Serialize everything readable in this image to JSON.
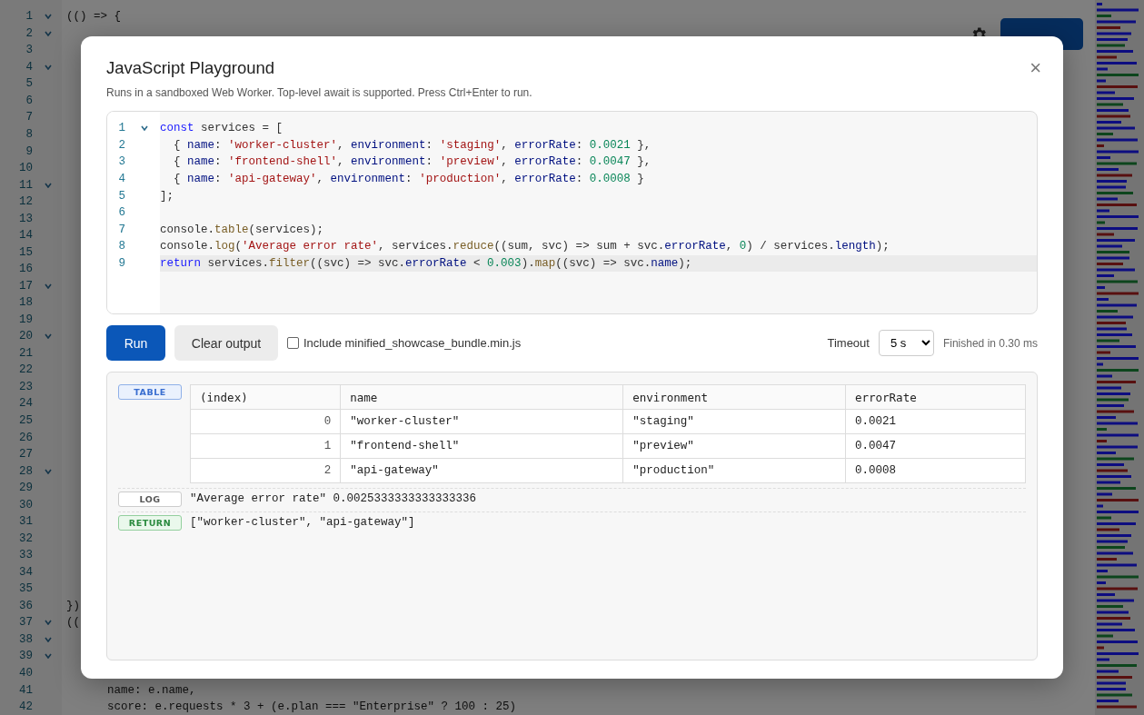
{
  "background_editor": {
    "lines": [
      {
        "number": "1",
        "fold": true,
        "code": "(() => {"
      },
      {
        "number": "2",
        "fold": true
      },
      {
        "number": "3",
        "fold": false
      },
      {
        "number": "4",
        "fold": true
      },
      {
        "number": "5",
        "fold": false
      },
      {
        "number": "6",
        "fold": false
      },
      {
        "number": "7",
        "fold": false
      },
      {
        "number": "8",
        "fold": false
      },
      {
        "number": "9",
        "fold": false
      },
      {
        "number": "10",
        "fold": false
      },
      {
        "number": "11",
        "fold": true
      },
      {
        "number": "12",
        "fold": false
      },
      {
        "number": "13",
        "fold": false
      },
      {
        "number": "14",
        "fold": false
      },
      {
        "number": "15",
        "fold": false
      },
      {
        "number": "16",
        "fold": false
      },
      {
        "number": "17",
        "fold": true
      },
      {
        "number": "18",
        "fold": false
      },
      {
        "number": "19",
        "fold": false
      },
      {
        "number": "20",
        "fold": true
      },
      {
        "number": "21",
        "fold": false
      },
      {
        "number": "22",
        "fold": false
      },
      {
        "number": "23",
        "fold": false
      },
      {
        "number": "24",
        "fold": false
      },
      {
        "number": "25",
        "fold": false
      },
      {
        "number": "26",
        "fold": false
      },
      {
        "number": "27",
        "fold": false
      },
      {
        "number": "28",
        "fold": true
      },
      {
        "number": "29",
        "fold": false
      },
      {
        "number": "30",
        "fold": false
      },
      {
        "number": "31",
        "fold": false
      },
      {
        "number": "32",
        "fold": false
      },
      {
        "number": "33",
        "fold": false
      },
      {
        "number": "34",
        "fold": false
      },
      {
        "number": "35",
        "fold": false
      },
      {
        "number": "36",
        "fold": false,
        "code": "})"
      },
      {
        "number": "37",
        "fold": true,
        "code": "(("
      },
      {
        "number": "38",
        "fold": true
      },
      {
        "number": "39",
        "fold": true
      },
      {
        "number": "40",
        "fold": false
      },
      {
        "number": "41",
        "fold": false,
        "code": "      name: e.name,"
      },
      {
        "number": "42",
        "fold": false,
        "code": "      score: e.requests * 3 + (e.plan === \"Enterprise\" ? 100 : 25)"
      }
    ]
  },
  "dialog": {
    "title": "JavaScript Playground",
    "subtitle": "Runs in a sandboxed Web Worker. Top-level await is supported. Press Ctrl+Enter to run.",
    "close": "×",
    "editor": {
      "lines": [
        {
          "number": "1",
          "fold": true,
          "current": false,
          "tokens": [
            {
              "kind": "kw",
              "text": "const"
            },
            {
              "kind": "plain",
              "text": " services = ["
            }
          ]
        },
        {
          "number": "2",
          "fold": false,
          "current": false,
          "tokens": [
            {
              "kind": "plain",
              "text": "  { "
            },
            {
              "kind": "prop",
              "text": "name"
            },
            {
              "kind": "plain",
              "text": ": "
            },
            {
              "kind": "str",
              "text": "'worker-cluster'"
            },
            {
              "kind": "plain",
              "text": ", "
            },
            {
              "kind": "prop",
              "text": "environment"
            },
            {
              "kind": "plain",
              "text": ": "
            },
            {
              "kind": "str",
              "text": "'staging'"
            },
            {
              "kind": "plain",
              "text": ", "
            },
            {
              "kind": "prop",
              "text": "errorRate"
            },
            {
              "kind": "plain",
              "text": ": "
            },
            {
              "kind": "num",
              "text": "0.0021"
            },
            {
              "kind": "plain",
              "text": " },"
            }
          ]
        },
        {
          "number": "3",
          "fold": false,
          "current": false,
          "tokens": [
            {
              "kind": "plain",
              "text": "  { "
            },
            {
              "kind": "prop",
              "text": "name"
            },
            {
              "kind": "plain",
              "text": ": "
            },
            {
              "kind": "str",
              "text": "'frontend-shell'"
            },
            {
              "kind": "plain",
              "text": ", "
            },
            {
              "kind": "prop",
              "text": "environment"
            },
            {
              "kind": "plain",
              "text": ": "
            },
            {
              "kind": "str",
              "text": "'preview'"
            },
            {
              "kind": "plain",
              "text": ", "
            },
            {
              "kind": "prop",
              "text": "errorRate"
            },
            {
              "kind": "plain",
              "text": ": "
            },
            {
              "kind": "num",
              "text": "0.0047"
            },
            {
              "kind": "plain",
              "text": " },"
            }
          ]
        },
        {
          "number": "4",
          "fold": false,
          "current": false,
          "tokens": [
            {
              "kind": "plain",
              "text": "  { "
            },
            {
              "kind": "prop",
              "text": "name"
            },
            {
              "kind": "plain",
              "text": ": "
            },
            {
              "kind": "str",
              "text": "'api-gateway'"
            },
            {
              "kind": "plain",
              "text": ", "
            },
            {
              "kind": "prop",
              "text": "environment"
            },
            {
              "kind": "plain",
              "text": ": "
            },
            {
              "kind": "str",
              "text": "'production'"
            },
            {
              "kind": "plain",
              "text": ", "
            },
            {
              "kind": "prop",
              "text": "errorRate"
            },
            {
              "kind": "plain",
              "text": ": "
            },
            {
              "kind": "num",
              "text": "0.0008"
            },
            {
              "kind": "plain",
              "text": " }"
            }
          ]
        },
        {
          "number": "5",
          "fold": false,
          "current": false,
          "tokens": [
            {
              "kind": "plain",
              "text": "];"
            }
          ]
        },
        {
          "number": "6",
          "fold": false,
          "current": false
        },
        {
          "number": "7",
          "fold": false,
          "current": false,
          "tokens": [
            {
              "kind": "plain",
              "text": "console."
            },
            {
              "kind": "fn",
              "text": "table"
            },
            {
              "kind": "plain",
              "text": "(services);"
            }
          ]
        },
        {
          "number": "8",
          "fold": false,
          "current": false,
          "tokens": [
            {
              "kind": "plain",
              "text": "console."
            },
            {
              "kind": "fn",
              "text": "log"
            },
            {
              "kind": "plain",
              "text": "("
            },
            {
              "kind": "str",
              "text": "'Average error rate'"
            },
            {
              "kind": "plain",
              "text": ", services."
            },
            {
              "kind": "fn",
              "text": "reduce"
            },
            {
              "kind": "plain",
              "text": "((sum, svc) => sum + svc."
            },
            {
              "kind": "prop",
              "text": "errorRate"
            },
            {
              "kind": "plain",
              "text": ", "
            },
            {
              "kind": "num",
              "text": "0"
            },
            {
              "kind": "plain",
              "text": ") / services."
            },
            {
              "kind": "prop",
              "text": "length"
            },
            {
              "kind": "plain",
              "text": ");"
            }
          ]
        },
        {
          "number": "9",
          "fold": false,
          "current": true,
          "tokens": [
            {
              "kind": "kw",
              "text": "return"
            },
            {
              "kind": "plain",
              "text": " services."
            },
            {
              "kind": "fn",
              "text": "filter"
            },
            {
              "kind": "plain",
              "text": "((svc) => svc."
            },
            {
              "kind": "prop",
              "text": "errorRate"
            },
            {
              "kind": "plain",
              "text": " < "
            },
            {
              "kind": "num",
              "text": "0.003"
            },
            {
              "kind": "plain",
              "text": ")."
            },
            {
              "kind": "fn",
              "text": "map"
            },
            {
              "kind": "plain",
              "text": "((svc) => svc."
            },
            {
              "kind": "prop",
              "text": "name"
            },
            {
              "kind": "plain",
              "text": ");"
            }
          ]
        }
      ]
    },
    "controls": {
      "run_button": "Run",
      "clear_button": "Clear output",
      "include_checkbox": {
        "label": "Include minified_showcase_bundle.min.js",
        "checked": false
      },
      "timeout": {
        "label": "Timeout",
        "value": "5 s"
      },
      "status": "Finished in 0.30 ms"
    },
    "output": [
      {
        "kind": "table",
        "badge": "TABLE",
        "columns": [
          "(index)",
          "name",
          "environment",
          "errorRate"
        ],
        "rows": [
          [
            "0",
            "\"worker-cluster\"",
            "\"staging\"",
            "0.0021"
          ],
          [
            "1",
            "\"frontend-shell\"",
            "\"preview\"",
            "0.0047"
          ],
          [
            "2",
            "\"api-gateway\"",
            "\"production\"",
            "0.0008"
          ]
        ]
      },
      {
        "kind": "log",
        "badge": "LOG",
        "text": "\"Average error rate\" 0.0025333333333333336"
      },
      {
        "kind": "return",
        "badge": "RETURN",
        "text": "[\"worker-cluster\", \"api-gateway\"]"
      }
    ]
  }
}
